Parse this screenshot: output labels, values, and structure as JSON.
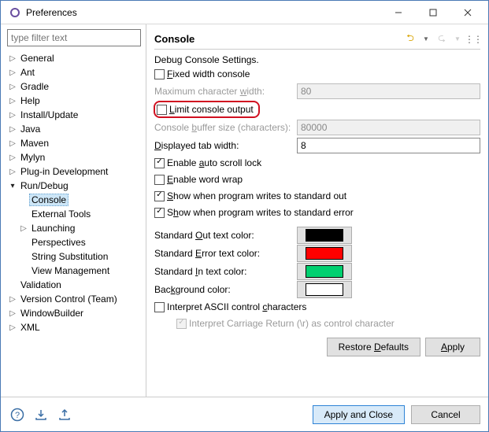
{
  "window": {
    "title": "Preferences"
  },
  "filter_placeholder": "type filter text",
  "tree": {
    "general": "General",
    "ant": "Ant",
    "gradle": "Gradle",
    "help": "Help",
    "install": "Install/Update",
    "java": "Java",
    "maven": "Maven",
    "mylyn": "Mylyn",
    "plugin": "Plug-in Development",
    "rundebug": "Run/Debug",
    "console": "Console",
    "external": "External Tools",
    "launching": "Launching",
    "perspectives": "Perspectives",
    "stringsub": "String Substitution",
    "viewmgmt": "View Management",
    "validation": "Validation",
    "vcs": "Version Control (Team)",
    "windowbuilder": "WindowBuilder",
    "xml": "XML"
  },
  "page": {
    "title": "Console",
    "settings_header": "Debug Console Settings.",
    "fixed_width": "Fixed width console",
    "max_width_label": "Maximum character width:",
    "max_width_value": "80",
    "limit_output": "Limit console output",
    "buffer_label": "Console buffer size (characters):",
    "buffer_value": "80000",
    "tabwidth_label": "Displayed tab width:",
    "tabwidth_value": "8",
    "autoscroll": "Enable auto scroll lock",
    "wordwrap": "Enable word wrap",
    "show_stdout": "Show when program writes to standard out",
    "show_stderr": "Show when program writes to standard error",
    "stdout_color_label": "Standard Out text color:",
    "stderr_color_label": "Standard Error text color:",
    "stdin_color_label": "Standard In text color:",
    "bg_color_label": "Background color:",
    "interpret_ascii": "Interpret ASCII control characters",
    "interpret_cr": "Interpret Carriage Return (\\r) as control character",
    "colors": {
      "stdout": "#000000",
      "stderr": "#ff0000",
      "stdin": "#00d070",
      "bg": "#ffffff"
    },
    "restore": "Restore Defaults",
    "apply": "Apply"
  },
  "footer": {
    "apply_close": "Apply and Close",
    "cancel": "Cancel"
  }
}
